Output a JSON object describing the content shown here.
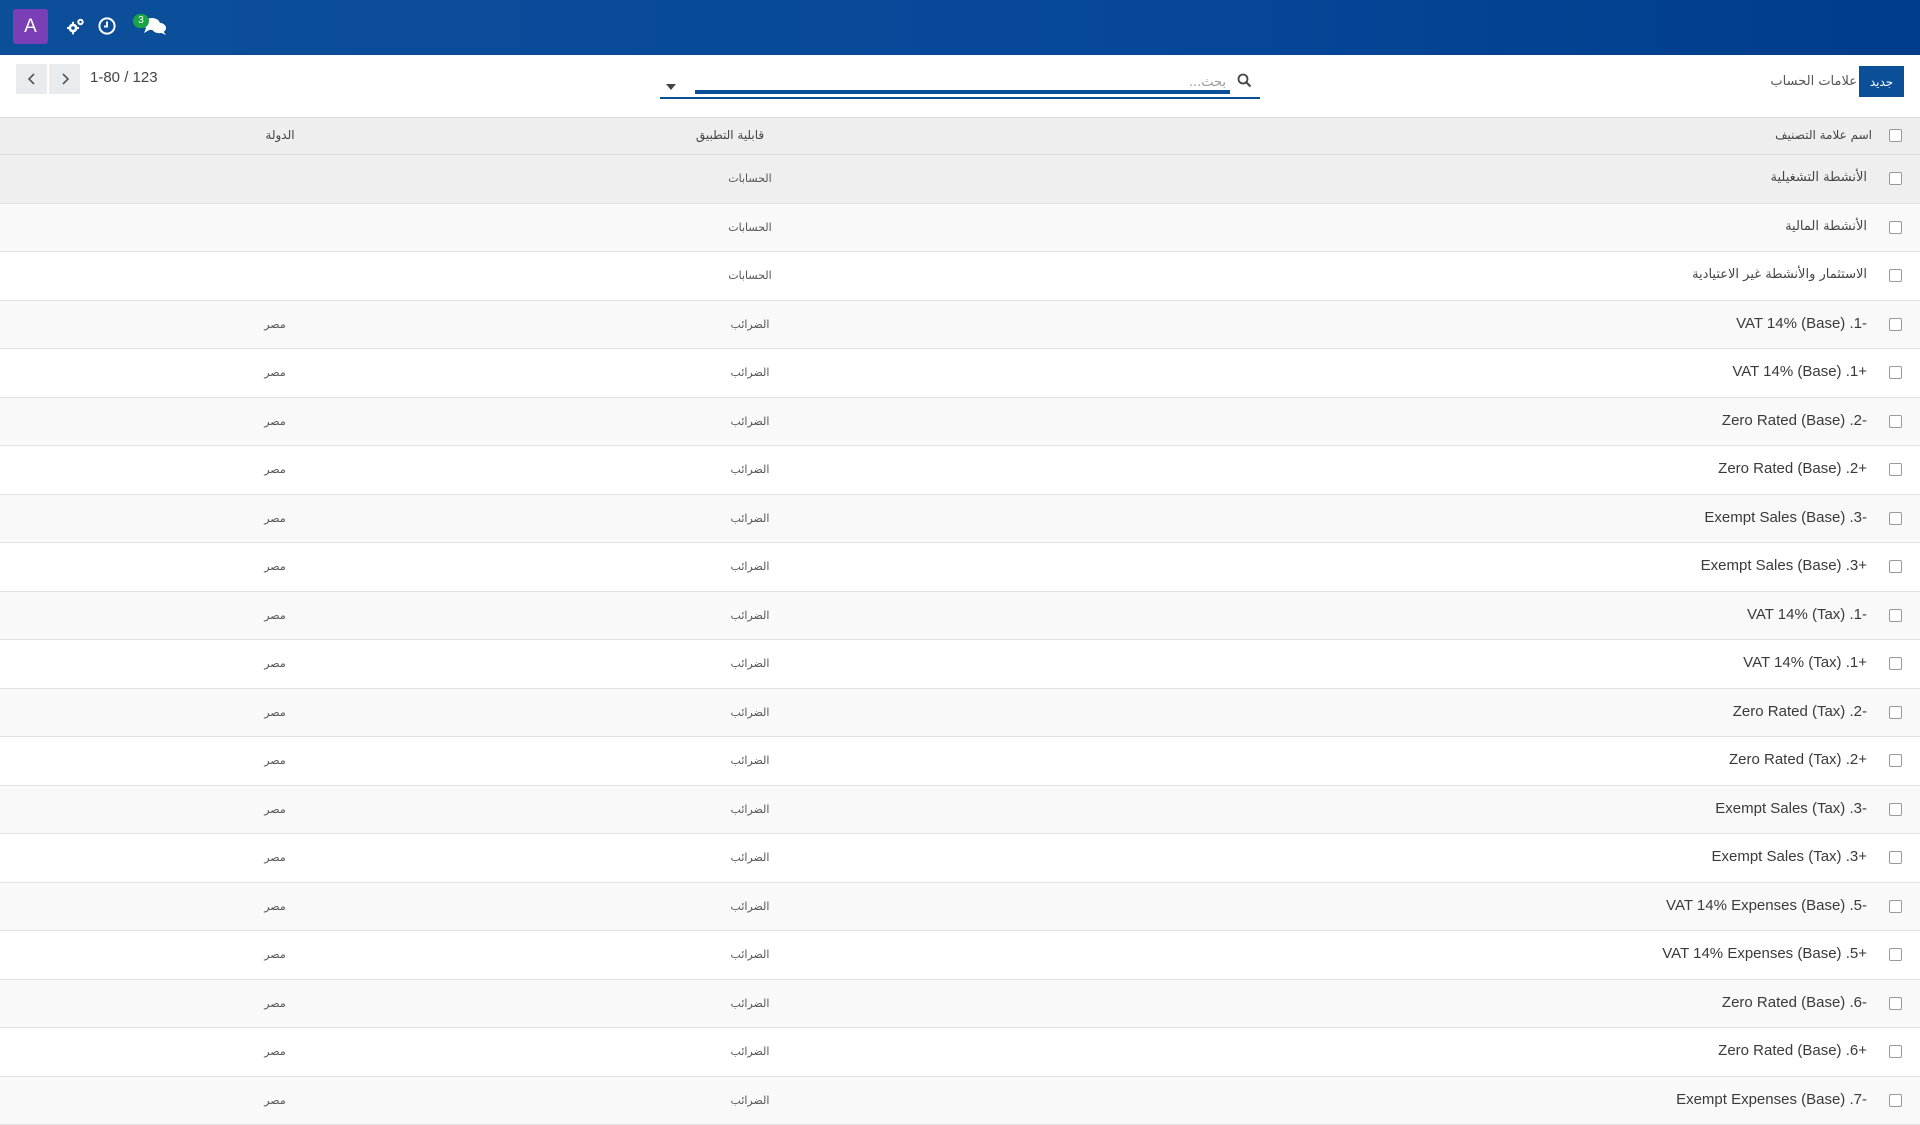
{
  "navbar": {
    "avatar_letter": "A",
    "messages_badge": "3",
    "icons": [
      "settings-cog-icon",
      "clock-icon",
      "chat-bubbles-icon"
    ],
    "brand_color": "#0c4f99"
  },
  "control_bar": {
    "new_button_label": "جديد",
    "breadcrumb_title": "علامات الحساب",
    "search_placeholder": "بحث...",
    "pager_text": "1-80 / 123"
  },
  "table": {
    "headers": {
      "name": "اسم علامة التصنيف",
      "applicability": "قابلية التطبيق",
      "country": "الدولة"
    },
    "rows": [
      {
        "name": "الأنشطة التشغيلية",
        "applicability": "الحسابات",
        "country": ""
      },
      {
        "name": "الأنشطة المالية",
        "applicability": "الحسابات",
        "country": ""
      },
      {
        "name": "الاستثمار والأنشطة غير الاعتيادية",
        "applicability": "الحسابات",
        "country": ""
      },
      {
        "name": "-1. VAT 14% (Base)",
        "applicability": "الضرائب",
        "country": "مصر"
      },
      {
        "name": "+1. VAT 14% (Base)",
        "applicability": "الضرائب",
        "country": "مصر"
      },
      {
        "name": "-2. Zero Rated (Base)",
        "applicability": "الضرائب",
        "country": "مصر"
      },
      {
        "name": "+2. Zero Rated (Base)",
        "applicability": "الضرائب",
        "country": "مصر"
      },
      {
        "name": "-3. Exempt Sales (Base)",
        "applicability": "الضرائب",
        "country": "مصر"
      },
      {
        "name": "+3. Exempt Sales (Base)",
        "applicability": "الضرائب",
        "country": "مصر"
      },
      {
        "name": "-1. VAT 14% (Tax)",
        "applicability": "الضرائب",
        "country": "مصر"
      },
      {
        "name": "+1. VAT 14% (Tax)",
        "applicability": "الضرائب",
        "country": "مصر"
      },
      {
        "name": "-2. Zero Rated (Tax)",
        "applicability": "الضرائب",
        "country": "مصر"
      },
      {
        "name": "+2. Zero Rated (Tax)",
        "applicability": "الضرائب",
        "country": "مصر"
      },
      {
        "name": "-3. Exempt Sales (Tax)",
        "applicability": "الضرائب",
        "country": "مصر"
      },
      {
        "name": "+3. Exempt Sales (Tax)",
        "applicability": "الضرائب",
        "country": "مصر"
      },
      {
        "name": "-5. VAT 14% Expenses (Base)",
        "applicability": "الضرائب",
        "country": "مصر"
      },
      {
        "name": "+5. VAT 14% Expenses (Base)",
        "applicability": "الضرائب",
        "country": "مصر"
      },
      {
        "name": "-6. Zero Rated (Base)",
        "applicability": "الضرائب",
        "country": "مصر"
      },
      {
        "name": "+6. Zero Rated (Base)",
        "applicability": "الضرائب",
        "country": "مصر"
      },
      {
        "name": "-7. Exempt Expenses (Base)",
        "applicability": "الضرائب",
        "country": "مصر"
      }
    ]
  }
}
